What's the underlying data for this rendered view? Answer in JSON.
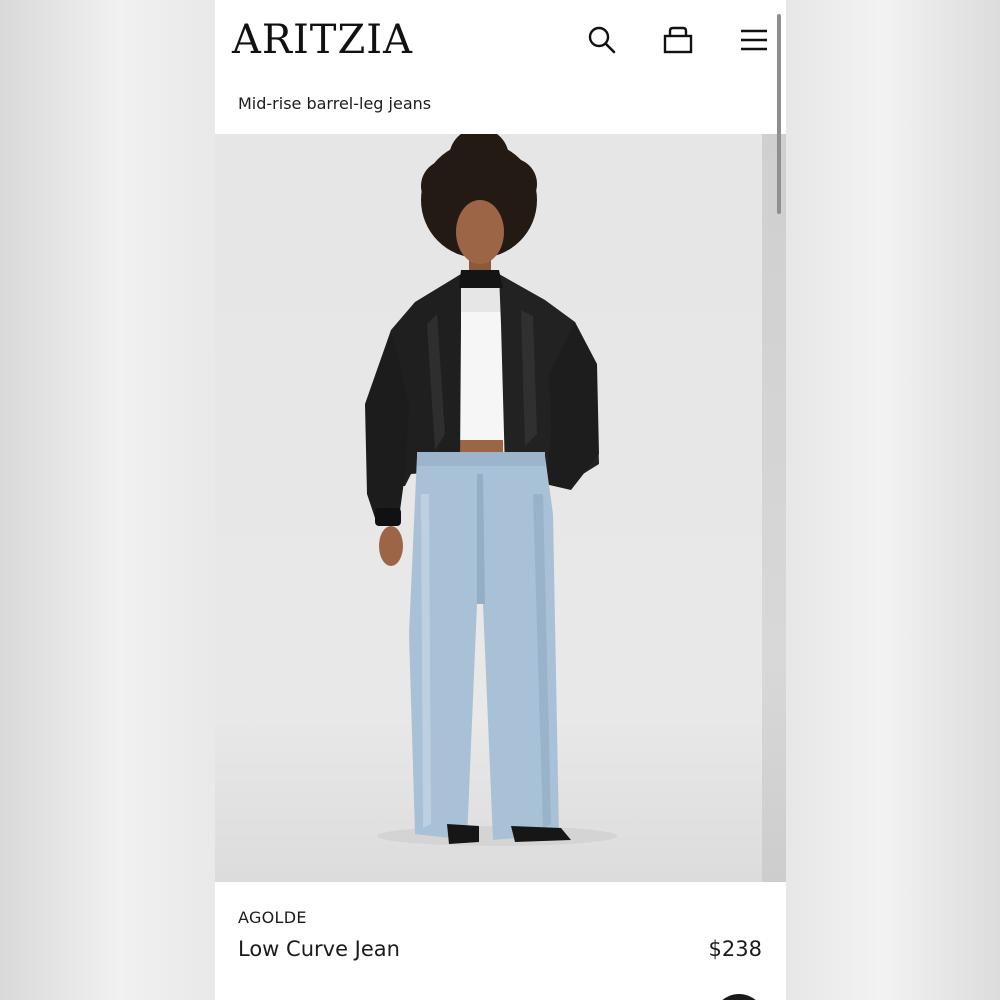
{
  "header": {
    "logo_text": "ARITZIA",
    "icons": [
      "search-icon",
      "shopping-bag-icon",
      "menu-icon"
    ]
  },
  "category": {
    "subtitle": "Mid-rise barrel-leg jeans"
  },
  "product": {
    "brand": "AGOLDE",
    "name": "Low Curve Jean",
    "price": "$238"
  },
  "colors": {
    "page_background": "#e4e4e4",
    "surface": "#ffffff",
    "text": "#1b1b1b",
    "hero_background": "#e6e6e6",
    "jacket": "#1f1f1f",
    "denim": "#a9c1d6"
  }
}
